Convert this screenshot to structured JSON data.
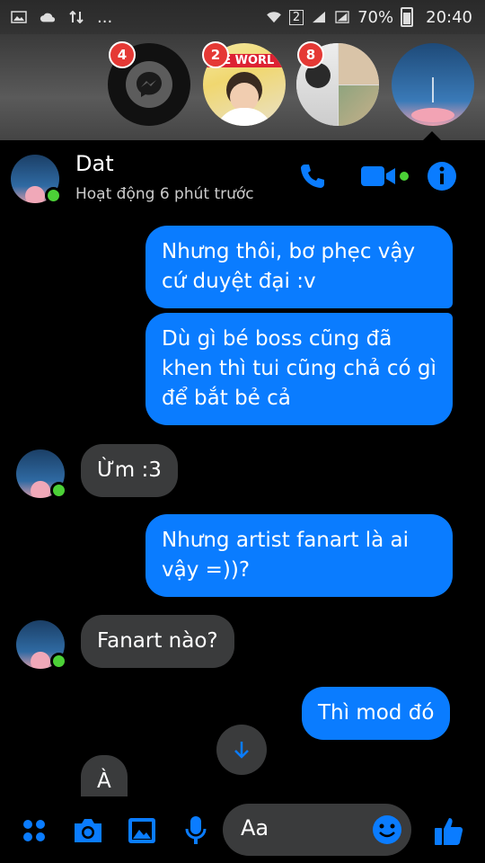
{
  "status_bar": {
    "left_dots": "...",
    "sim_badge": "2",
    "battery": "70%",
    "time": "20:40"
  },
  "chat_heads": [
    {
      "name": "messenger",
      "count": "4"
    },
    {
      "name": "contact-2",
      "count": "2",
      "caption": "PE WORL"
    },
    {
      "name": "contact-3",
      "count": "8"
    },
    {
      "name": "dat",
      "count": ""
    }
  ],
  "header": {
    "title": "Dat",
    "subtitle": "Hoạt động 6 phút trước",
    "icons": [
      "phone-icon",
      "video-camera-icon",
      "info-icon"
    ]
  },
  "messages": [
    {
      "side": "out",
      "text": "Nhưng thôi, bơ phẹc vậy cứ duyệt đại :v"
    },
    {
      "side": "out",
      "text": "Dù gì bé boss cũng đã khen thì tui cũng chả có gì để bắt bẻ cả"
    },
    {
      "side": "in",
      "text": "Ừm :3"
    },
    {
      "side": "out",
      "text": "Nhưng artist fanart là ai vậy =))?"
    },
    {
      "side": "in",
      "text": "Fanart nào?"
    },
    {
      "side": "out",
      "text": "Thì mod đó"
    },
    {
      "side": "in",
      "text": "À"
    }
  ],
  "composer": {
    "placeholder": "Aa",
    "icons": [
      "apps-icon",
      "camera-icon",
      "gallery-icon",
      "microphone-icon",
      "emoji-icon",
      "thumbs-up-icon"
    ]
  },
  "colors": {
    "accent": "#0a7cff",
    "incoming_bubble": "#3a3b3c",
    "online": "#4cd137",
    "badge": "#e53935"
  }
}
